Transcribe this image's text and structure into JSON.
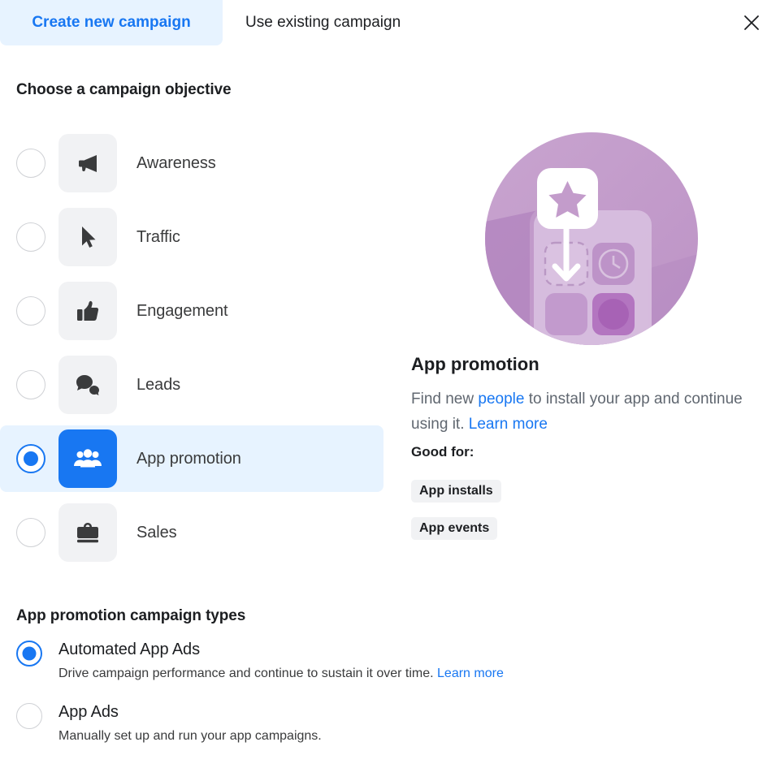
{
  "tabs": [
    {
      "label": "Create new campaign",
      "active": true,
      "name": "tab-create-new-campaign"
    },
    {
      "label": "Use existing campaign",
      "active": false,
      "name": "tab-use-existing-campaign"
    }
  ],
  "close_label": "Close",
  "objective_section": {
    "title": "Choose a campaign objective",
    "items": [
      {
        "label": "Awareness",
        "icon": "megaphone-icon",
        "selected": false
      },
      {
        "label": "Traffic",
        "icon": "cursor-icon",
        "selected": false
      },
      {
        "label": "Engagement",
        "icon": "thumbs-up-icon",
        "selected": false
      },
      {
        "label": "Leads",
        "icon": "speech-bubbles-icon",
        "selected": false
      },
      {
        "label": "App promotion",
        "icon": "people-group-icon",
        "selected": true
      },
      {
        "label": "Sales",
        "icon": "briefcase-icon",
        "selected": false
      }
    ]
  },
  "detail": {
    "illustration": "app-promotion-illustration",
    "heading": "App promotion",
    "desc_part1": "Find new ",
    "desc_link1": "people",
    "desc_part2": " to install your app and continue using it. ",
    "desc_link2": "Learn more",
    "good_for_label": "Good for:",
    "pills": [
      "App installs",
      "App events"
    ]
  },
  "types_section": {
    "title": "App promotion campaign types",
    "items": [
      {
        "name": "Automated App Ads",
        "desc": "Drive campaign performance and continue to sustain it over time. ",
        "link": "Learn more",
        "selected": true
      },
      {
        "name": "App Ads",
        "desc": "Manually set up and run your app campaigns.",
        "link": "",
        "selected": false
      }
    ]
  },
  "colors": {
    "accent": "#1877f2",
    "accent_bg": "#e7f3ff",
    "tile_bg": "#f1f2f4",
    "text_primary": "#1c1e21",
    "text_secondary": "#606770",
    "illustration_circle": "#c5a0cc"
  }
}
